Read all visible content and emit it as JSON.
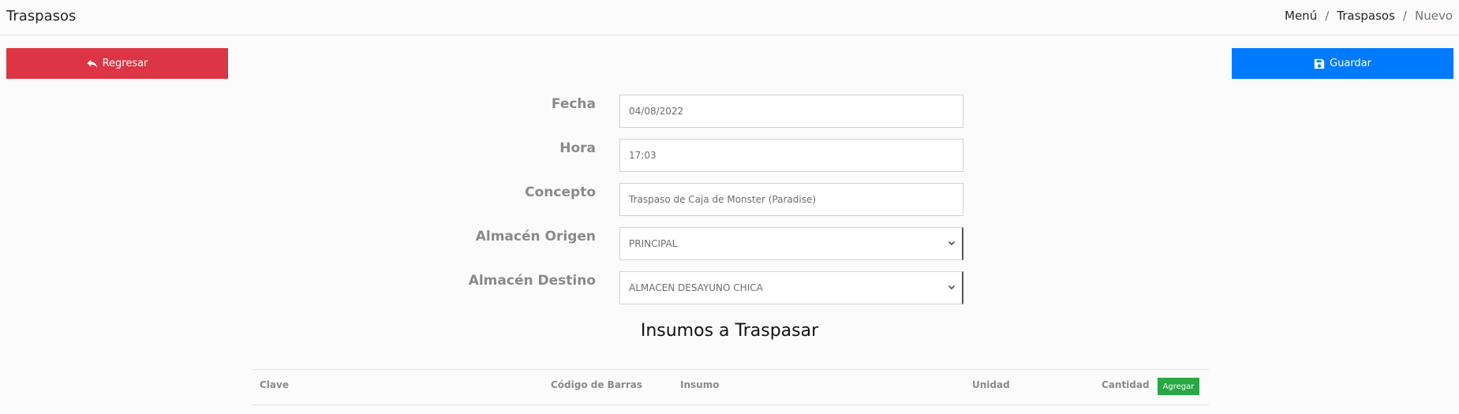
{
  "header": {
    "title": "Traspasos",
    "breadcrumb": [
      {
        "label": "Menú"
      },
      {
        "label": "Traspasos"
      },
      {
        "label": "Nuevo"
      }
    ],
    "separator": "/"
  },
  "actions": {
    "back_label": "Regresar",
    "back_icon": "reply-arrow-icon",
    "save_label": "Guardar",
    "save_icon": "floppy-disk-icon"
  },
  "form": {
    "fecha": {
      "label": "Fecha",
      "value": "04/08/2022"
    },
    "hora": {
      "label": "Hora",
      "value": "17:03"
    },
    "concepto": {
      "label": "Concepto",
      "value": "Traspaso de Caja de Monster (Paradise)"
    },
    "almacen_origen": {
      "label": "Almacén Origen",
      "value": "PRINCIPAL"
    },
    "almacen_destino": {
      "label": "Almacén Destino",
      "value": "ALMACEN DESAYUNO CHICA"
    }
  },
  "section": {
    "title": "Insumos a Traspasar"
  },
  "table": {
    "columns": [
      "Clave",
      "Código de Barras",
      "Insumo",
      "Unidad",
      "Cantidad"
    ],
    "add_label": "Agregar"
  },
  "colors": {
    "danger": "#dc3545",
    "primary": "#007bff",
    "success": "#28a745"
  }
}
